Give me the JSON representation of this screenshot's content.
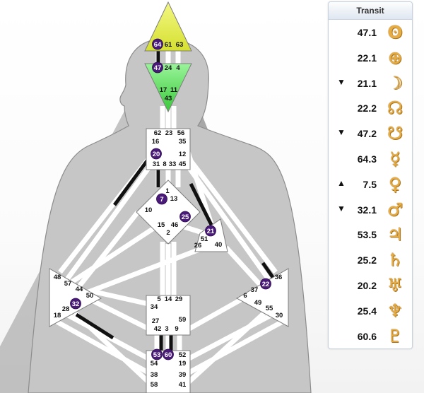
{
  "transit": {
    "title": "Transit",
    "rows": [
      {
        "value": "47.1",
        "direction": "",
        "planet": "sun-icon",
        "glyph": "ʘ"
      },
      {
        "value": "22.1",
        "direction": "",
        "planet": "earth-icon",
        "glyph": "⊕"
      },
      {
        "value": "21.1",
        "direction": "▼",
        "planet": "moon-icon",
        "glyph": "☽"
      },
      {
        "value": "22.2",
        "direction": "",
        "planet": "north-node-icon",
        "glyph": "☊"
      },
      {
        "value": "47.2",
        "direction": "▼",
        "planet": "south-node-icon",
        "glyph": "☋"
      },
      {
        "value": "64.3",
        "direction": "",
        "planet": "mercury-icon",
        "glyph": "☿"
      },
      {
        "value": "7.5",
        "direction": "▲",
        "planet": "venus-icon",
        "glyph": "♀"
      },
      {
        "value": "32.1",
        "direction": "▼",
        "planet": "mars-icon",
        "glyph": "♂"
      },
      {
        "value": "53.5",
        "direction": "",
        "planet": "jupiter-icon",
        "glyph": "♃"
      },
      {
        "value": "25.2",
        "direction": "",
        "planet": "saturn-icon",
        "glyph": "♄"
      },
      {
        "value": "20.2",
        "direction": "",
        "planet": "uranus-icon",
        "glyph": "♅"
      },
      {
        "value": "25.4",
        "direction": "",
        "planet": "neptune-icon",
        "glyph": "♆"
      },
      {
        "value": "60.6",
        "direction": "",
        "planet": "pluto-icon",
        "glyph": "♇"
      }
    ]
  },
  "colors": {
    "head_center": "#e8f04a",
    "ajna_center": "#6fe86a",
    "white_center": "#ffffff",
    "channel_active": "#111111",
    "gate_active": "#4a1a7a",
    "planet_gold": "#e6ad45"
  },
  "gates": {
    "head": [
      "64",
      "61",
      "63"
    ],
    "ajna": [
      "47",
      "24",
      "4",
      "17",
      "11",
      "43"
    ],
    "throat": [
      "62",
      "23",
      "56",
      "16",
      "35",
      "20",
      "12",
      "31",
      "8",
      "33",
      "45"
    ],
    "g_center": [
      "1",
      "7",
      "13",
      "10",
      "25",
      "15",
      "46",
      "2"
    ],
    "heart": [
      "21",
      "51",
      "26",
      "40"
    ],
    "sacral": [
      "5",
      "14",
      "29",
      "34",
      "27",
      "59",
      "42",
      "3",
      "9"
    ],
    "spleen": [
      "48",
      "57",
      "44",
      "50",
      "32",
      "28",
      "18"
    ],
    "solar_plexus": [
      "36",
      "22",
      "37",
      "6",
      "49",
      "55",
      "30"
    ],
    "root": [
      "53",
      "60",
      "52",
      "54",
      "19",
      "38",
      "39",
      "58",
      "41"
    ]
  },
  "active_gates": [
    "64",
    "47",
    "20",
    "7",
    "25",
    "21",
    "22",
    "32",
    "53",
    "60"
  ]
}
